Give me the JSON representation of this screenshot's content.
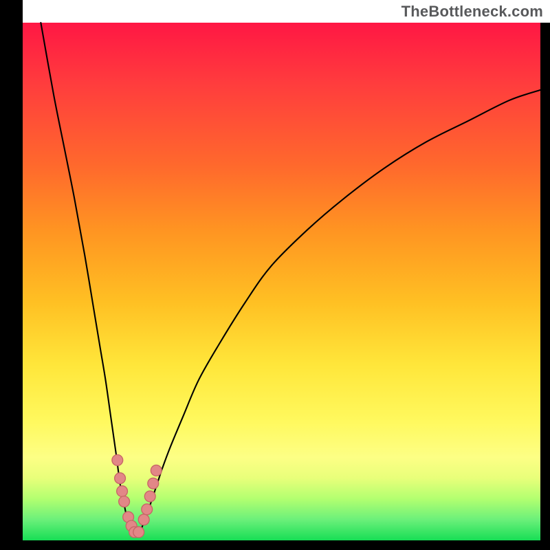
{
  "attribution": "TheBottleneck.com",
  "colors": {
    "frame": "#000000",
    "gradient_top": "#ff1744",
    "gradient_bottom": "#17de55",
    "curve": "#000000",
    "dot_fill": "#e28787",
    "dot_stroke": "#c76666"
  },
  "chart_data": {
    "type": "line",
    "title": "",
    "xlabel": "",
    "ylabel": "",
    "xlim": [
      0,
      100
    ],
    "ylim": [
      0,
      100
    ],
    "series": [
      {
        "name": "left-branch",
        "x": [
          3.5,
          6,
          8,
          10,
          12,
          14,
          15,
          16,
          17,
          18,
          18.8,
          19.4,
          20,
          20.6,
          21.2,
          22
        ],
        "values": [
          100,
          86,
          76,
          66,
          55,
          43,
          37,
          31,
          24,
          17,
          11,
          8,
          5,
          3,
          2,
          1
        ]
      },
      {
        "name": "right-branch",
        "x": [
          22,
          22.8,
          23.4,
          24,
          25,
          26,
          27,
          28.5,
          31,
          34,
          38,
          43,
          48,
          55,
          62,
          70,
          78,
          86,
          94,
          100
        ],
        "values": [
          1,
          2,
          3.5,
          5,
          8,
          11,
          14,
          18,
          24,
          31,
          38,
          46,
          53,
          60,
          66,
          72,
          77,
          81,
          85,
          87
        ]
      },
      {
        "name": "dots",
        "x": [
          18.3,
          18.8,
          19.2,
          19.6,
          20.4,
          21.0,
          21.6,
          22.4,
          23.4,
          24.0,
          24.6,
          25.2,
          25.8
        ],
        "values": [
          15.5,
          12.0,
          9.5,
          7.5,
          4.5,
          2.8,
          1.6,
          1.6,
          4.0,
          6.0,
          8.5,
          11.0,
          13.5
        ]
      }
    ],
    "notes": "V-shaped bottleneck curve over a vertical red-to-green gradient. Minimum of the curve sits near x≈22, y≈1. Salmon dots cluster around the trough of the V. Axes are not labeled; values are read by position relative to the 0–100 plot extent."
  }
}
